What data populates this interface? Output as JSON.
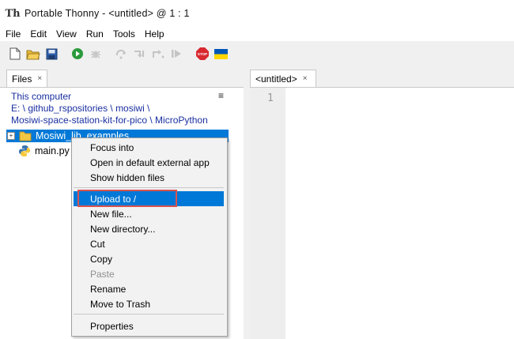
{
  "window": {
    "title": "Portable Thonny  -  <untitled>  @  1 : 1",
    "app_icon": "thonny-icon"
  },
  "menu": [
    "File",
    "Edit",
    "View",
    "Run",
    "Tools",
    "Help"
  ],
  "toolbar": {
    "icons": [
      "new-file-icon",
      "open-folder-icon",
      "save-icon",
      "run-icon",
      "debug-icon",
      "step-over-icon",
      "step-into-icon",
      "step-out-icon",
      "resume-icon",
      "stop-icon",
      "ukraine-flag-icon"
    ],
    "stop_label": "STOP"
  },
  "files_panel": {
    "tab_label": "Files",
    "tab_close": "×",
    "location_title": "This computer",
    "path_line_1": "E: \\ github_rspositories \\ mosiwi \\",
    "path_line_2": "Mosiwi-space-station-kit-for-pico \\ MicroPython",
    "menu_glyph": "≡",
    "tree": [
      {
        "name": "Mosiwi_lib_examples",
        "type": "folder",
        "expander": "+",
        "selected": true
      },
      {
        "name": "main.py",
        "type": "python-file",
        "selected": false
      }
    ]
  },
  "editor": {
    "tab_label": "<untitled>",
    "tab_close": "×",
    "line_numbers": [
      "1"
    ]
  },
  "context_menu": {
    "items": [
      {
        "label": "Focus into",
        "enabled": true
      },
      {
        "label": "Open in default external app",
        "enabled": true
      },
      {
        "label": "Show hidden files",
        "enabled": true
      },
      {
        "label": "Upload to /",
        "enabled": true,
        "highlighted": true
      },
      {
        "label": "New file...",
        "enabled": true
      },
      {
        "label": "New directory...",
        "enabled": true
      },
      {
        "label": "Cut",
        "enabled": true
      },
      {
        "label": "Copy",
        "enabled": true
      },
      {
        "label": "Paste",
        "enabled": false
      },
      {
        "label": "Rename",
        "enabled": true
      },
      {
        "label": "Move to Trash",
        "enabled": true
      },
      {
        "label": "Properties",
        "enabled": true
      }
    ]
  },
  "colors": {
    "selection": "#0078d7",
    "path_text": "#1a2fa0",
    "annotation_box": "#d9534f"
  }
}
